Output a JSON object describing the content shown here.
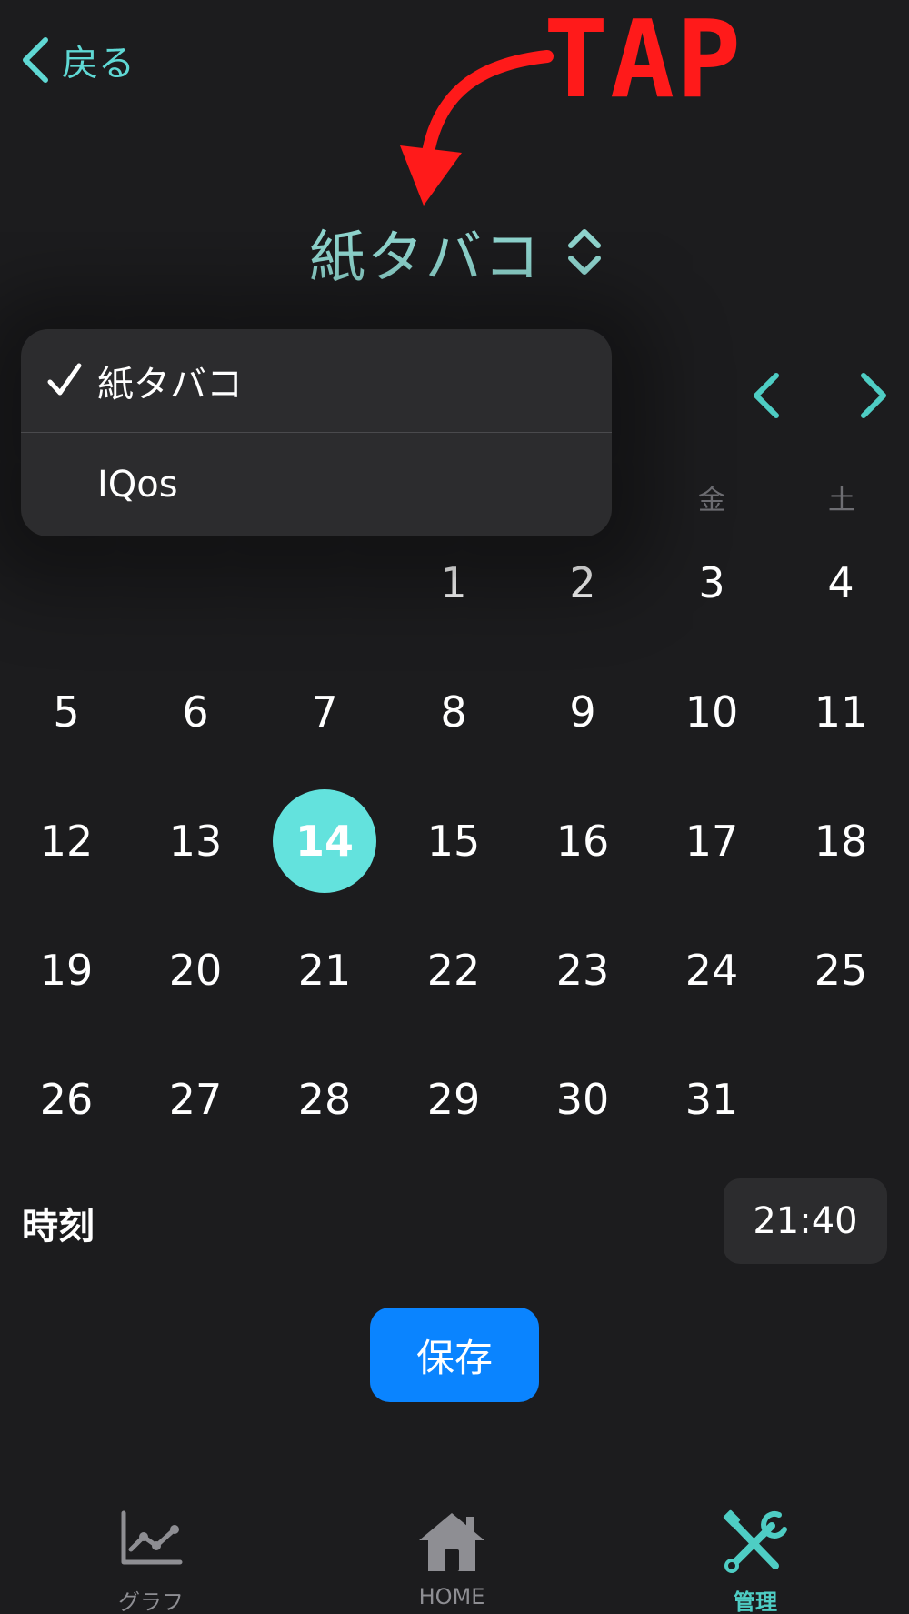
{
  "header": {
    "back_label": "戻る",
    "picker_label": "紙タバコ"
  },
  "annotation": {
    "text": "TAP",
    "color": "#ff1a1a"
  },
  "menu": {
    "items": [
      {
        "label": "紙タバコ",
        "checked": true
      },
      {
        "label": "IQos",
        "checked": false
      }
    ]
  },
  "calendar": {
    "weekdays_visible": [
      "金",
      "土"
    ],
    "selected_day": "14",
    "weeks": [
      [
        "",
        "",
        "",
        "1",
        "2",
        "3",
        "4"
      ],
      [
        "5",
        "6",
        "7",
        "8",
        "9",
        "10",
        "11"
      ],
      [
        "12",
        "13",
        "14",
        "15",
        "16",
        "17",
        "18"
      ],
      [
        "19",
        "20",
        "21",
        "22",
        "23",
        "24",
        "25"
      ],
      [
        "26",
        "27",
        "28",
        "29",
        "30",
        "31",
        ""
      ]
    ]
  },
  "time": {
    "label": "時刻",
    "value": "21:40"
  },
  "save_label": "保存",
  "tabbar": {
    "items": [
      {
        "label": "グラフ",
        "icon": "graph-icon",
        "active": false
      },
      {
        "label": "HOME",
        "icon": "home-icon",
        "active": false
      },
      {
        "label": "管理",
        "icon": "tools-icon",
        "active": true
      }
    ]
  },
  "colors": {
    "accent": "#5fd8d4",
    "selected_day": "#63e2dd",
    "save_button": "#0a84ff",
    "background": "#1c1c1e"
  }
}
